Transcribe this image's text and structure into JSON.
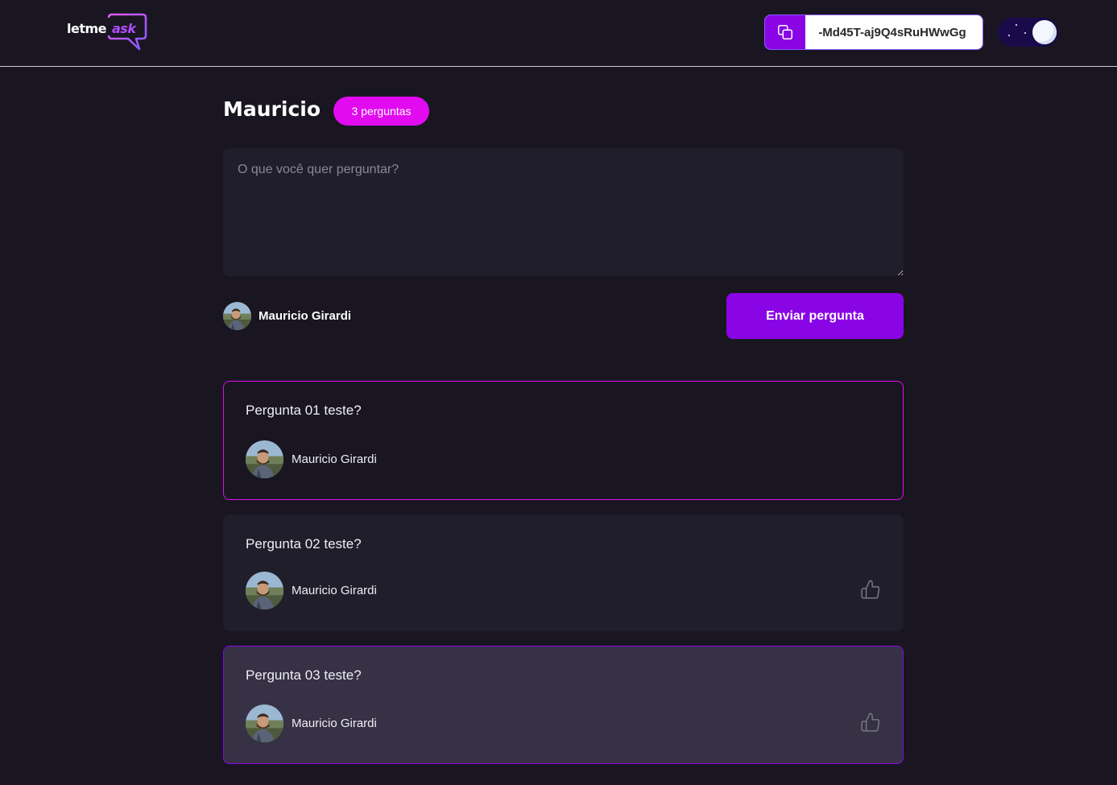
{
  "header": {
    "logo_text": "letme",
    "logo_accent": "ask",
    "room_code": "-Md45T-aj9Q4sRuHWwGg",
    "copy_icon": "copy-icon",
    "theme_toggle_state": "dark"
  },
  "room": {
    "title": "Mauricio",
    "question_count_label": "3 perguntas"
  },
  "form": {
    "placeholder": "O que você quer perguntar?",
    "user_name": "Mauricio Girardi",
    "submit_label": "Enviar pergunta"
  },
  "questions": [
    {
      "content": "Pergunta 01 teste?",
      "author": "Mauricio Girardi",
      "state": "highlighted-border",
      "like_icon": null
    },
    {
      "content": "Pergunta 02 teste?",
      "author": "Mauricio Girardi",
      "state": "default",
      "like_icon": "thumbs-up-icon"
    },
    {
      "content": "Pergunta 03 teste?",
      "author": "Mauricio Girardi",
      "state": "highlighted",
      "like_icon": "thumbs-up-icon"
    }
  ],
  "colors": {
    "background": "#191622",
    "accent_purple": "#8a05e6",
    "accent_pink": "#e20bf0",
    "card": "#211e2b",
    "card_highlight": "#363145"
  }
}
